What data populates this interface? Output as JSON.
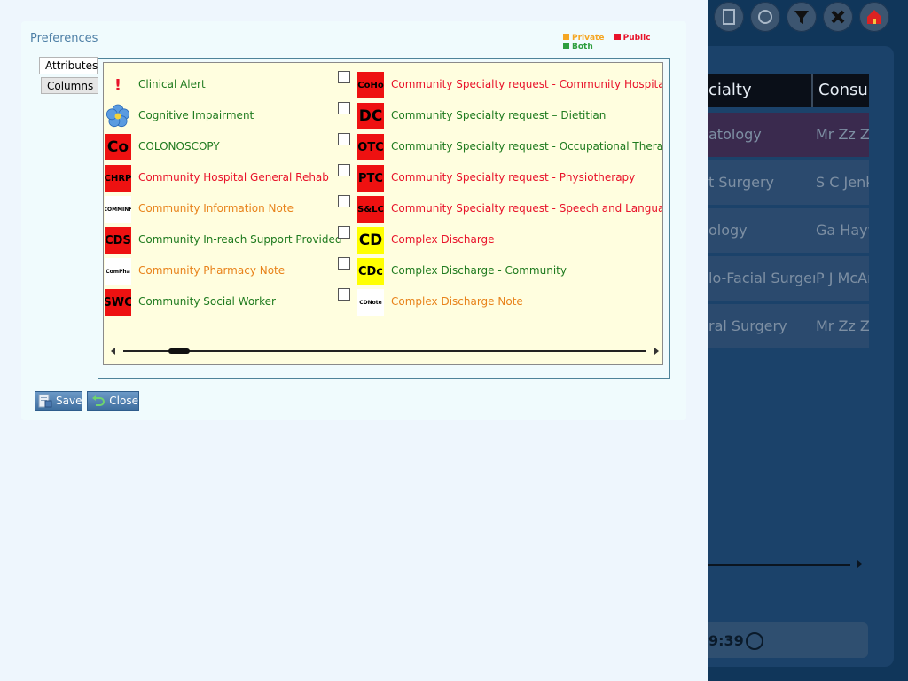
{
  "dialog": {
    "title": "Preferences",
    "legend": [
      {
        "label": "Private",
        "color": "#f5a623"
      },
      {
        "label": "Public",
        "color": "#e8122a"
      },
      {
        "label": "Both",
        "color": "#2e9e3e"
      }
    ],
    "tabs": [
      "Attributes",
      "Columns"
    ],
    "buttons": {
      "save": "Save",
      "close": "Close"
    }
  },
  "attributes_left": [
    {
      "icon": "!",
      "icon_bg": "#fffedf",
      "icon_color": "#e8122a",
      "label": "Clinical Alert",
      "scope": "Both",
      "label_color": "#1e7a1e"
    },
    {
      "icon": "flower-icon",
      "icon_bg": "#fffedf",
      "label": "Cognitive Impairment",
      "scope": "Both",
      "label_color": "#1e7a1e"
    },
    {
      "icon": "Co",
      "icon_bg": "#ee1111",
      "label": "COLONOSCOPY",
      "scope": "Both",
      "label_color": "#1e7a1e"
    },
    {
      "icon": "CHRP",
      "icon_bg": "#ee1111",
      "label": "Community Hospital General Rehab",
      "scope": "Public",
      "label_color": "#e8122a"
    },
    {
      "icon": "COMMINF",
      "icon_bg": "#ffffff",
      "label": "Community Information Note",
      "scope": "Private",
      "label_color": "#e8821a"
    },
    {
      "icon": "CDS",
      "icon_bg": "#ee1111",
      "label": "Community In-reach Support Provided",
      "scope": "Both",
      "label_color": "#1e7a1e"
    },
    {
      "icon": "ComPha",
      "icon_bg": "#ffffff",
      "label": "Community Pharmacy Note",
      "scope": "Private",
      "label_color": "#e8821a"
    },
    {
      "icon": "SWC",
      "icon_bg": "#ee1111",
      "label": "Community Social Worker",
      "scope": "Both",
      "label_color": "#1e7a1e"
    }
  ],
  "attributes_right": [
    {
      "icon": "CoHo",
      "icon_bg": "#ee1111",
      "label": "Community Specialty request - Community Hospital",
      "scope": "Public",
      "label_color": "#e8122a"
    },
    {
      "icon": "DC",
      "icon_bg": "#ee1111",
      "label": "Community Specialty request – Dietitian",
      "scope": "Both",
      "label_color": "#1e7a1e"
    },
    {
      "icon": "OTC",
      "icon_bg": "#ee1111",
      "label": "Community Specialty request - Occupational Therapy",
      "scope": "Both",
      "label_color": "#1e7a1e"
    },
    {
      "icon": "PTC",
      "icon_bg": "#ee1111",
      "label": "Community Specialty request - Physiotherapy",
      "scope": "Public",
      "label_color": "#e8122a"
    },
    {
      "icon": "S&LC",
      "icon_bg": "#ee1111",
      "label": "Community Specialty request - Speech and Language The",
      "scope": "Public",
      "label_color": "#e8122a"
    },
    {
      "icon": "CD",
      "icon_bg": "#ffff00",
      "label": "Complex Discharge",
      "scope": "Public",
      "label_color": "#e8122a"
    },
    {
      "icon": "CDc",
      "icon_bg": "#ffff00",
      "label": "Complex Discharge - Community",
      "scope": "Both",
      "label_color": "#1e7a1e"
    },
    {
      "icon": "CDNote",
      "icon_bg": "#ffffff",
      "label": "Complex Discharge Note",
      "scope": "Private",
      "label_color": "#e8821a"
    }
  ],
  "background_app": {
    "grid_headers": [
      "cialty",
      "Consult"
    ],
    "rows": [
      {
        "c1": "atology",
        "c2": "Mr Zz Zz",
        "bg": "#3a2a4e"
      },
      {
        "c1": "t Surgery",
        "c2": "S C Jenk",
        "bg": "#2b4a6e"
      },
      {
        "c1": "ology",
        "c2": "Ga Hayw",
        "bg": "#2b4a6e"
      },
      {
        "c1": "lo-Facial Surgery",
        "c2": "P J McAr",
        "bg": "#2b4a6e"
      },
      {
        "c1": "ral Surgery",
        "c2": "Mr Zz Zz",
        "bg": "#2b4a6e"
      }
    ],
    "footer_time": "9:39"
  }
}
